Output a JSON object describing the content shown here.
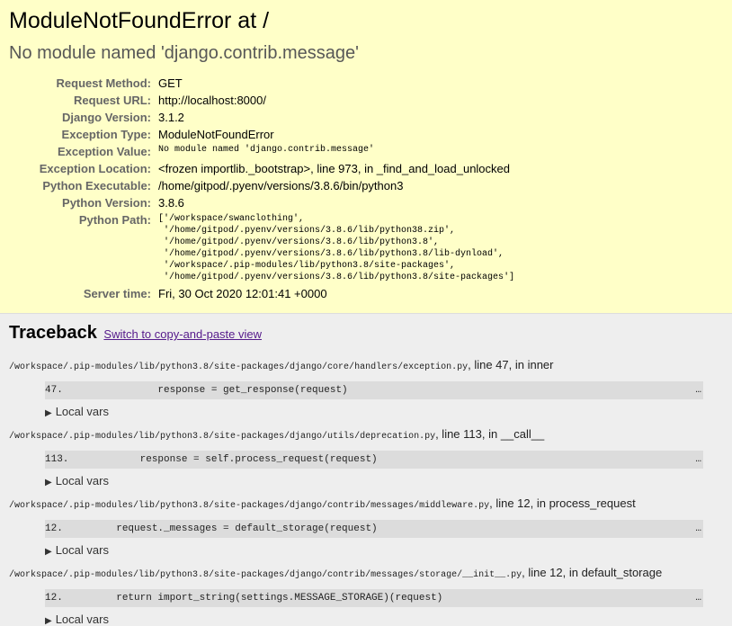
{
  "summary": {
    "title": "ModuleNotFoundError at /",
    "message": "No module named 'django.contrib.message'",
    "meta": [
      {
        "label": "Request Method:",
        "value": "GET",
        "mono": false
      },
      {
        "label": "Request URL:",
        "value": "http://localhost:8000/",
        "mono": false
      },
      {
        "label": "Django Version:",
        "value": "3.1.2",
        "mono": false
      },
      {
        "label": "Exception Type:",
        "value": "ModuleNotFoundError",
        "mono": false
      },
      {
        "label": "Exception Value:",
        "value": "No module named 'django.contrib.message'",
        "mono": true
      },
      {
        "label": "Exception Location:",
        "value": "<frozen importlib._bootstrap>, line 973, in _find_and_load_unlocked",
        "mono": false
      },
      {
        "label": "Python Executable:",
        "value": "/home/gitpod/.pyenv/versions/3.8.6/bin/python3",
        "mono": false
      },
      {
        "label": "Python Version:",
        "value": "3.8.6",
        "mono": false
      },
      {
        "label": "Python Path:",
        "value": "['/workspace/swanclothing',\n '/home/gitpod/.pyenv/versions/3.8.6/lib/python38.zip',\n '/home/gitpod/.pyenv/versions/3.8.6/lib/python3.8',\n '/home/gitpod/.pyenv/versions/3.8.6/lib/python3.8/lib-dynload',\n '/workspace/.pip-modules/lib/python3.8/site-packages',\n '/home/gitpod/.pyenv/versions/3.8.6/lib/python3.8/site-packages']",
        "mono": true,
        "pre": true
      },
      {
        "label": "Server time:",
        "value": "Fri, 30 Oct 2020 12:01:41 +0000",
        "mono": false
      }
    ]
  },
  "traceback": {
    "heading": "Traceback",
    "switch_link": "Switch to copy-and-paste view",
    "local_vars_label": "Local vars",
    "ellipsis": "…",
    "frames": [
      {
        "file": "/workspace/.pip-modules/lib/python3.8/site-packages/django/core/handlers/exception.py",
        "suffix": ", line 47, in inner",
        "line": "47.                response = get_response(request)"
      },
      {
        "file": "/workspace/.pip-modules/lib/python3.8/site-packages/django/utils/deprecation.py",
        "suffix": ", line 113, in __call__",
        "line": "113.            response = self.process_request(request)"
      },
      {
        "file": "/workspace/.pip-modules/lib/python3.8/site-packages/django/contrib/messages/middleware.py",
        "suffix": ", line 12, in process_request",
        "line": "12.         request._messages = default_storage(request)"
      },
      {
        "file": "/workspace/.pip-modules/lib/python3.8/site-packages/django/contrib/messages/storage/__init__.py",
        "suffix": ", line 12, in default_storage",
        "line": "12.         return import_string(settings.MESSAGE_STORAGE)(request)"
      }
    ]
  }
}
